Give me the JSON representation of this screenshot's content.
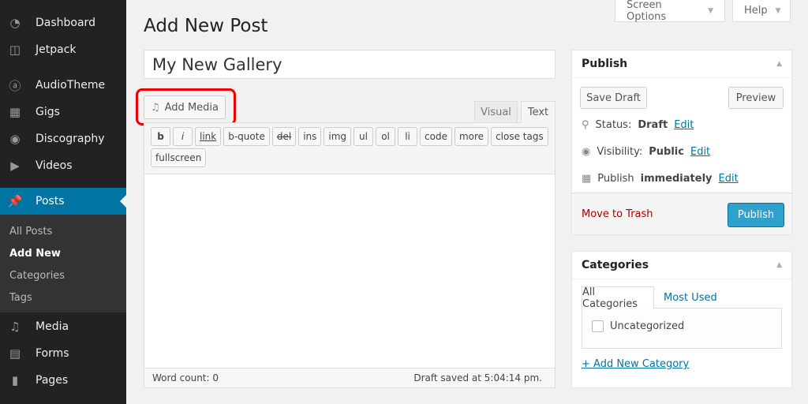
{
  "sidebar": {
    "items": [
      {
        "label": "Dashboard",
        "icon": "dashboard-icon"
      },
      {
        "label": "Jetpack",
        "icon": "jetpack-icon"
      },
      {
        "label": "AudioTheme",
        "icon": "audiotheme-icon"
      },
      {
        "label": "Gigs",
        "icon": "calendar-icon"
      },
      {
        "label": "Discography",
        "icon": "disc-icon"
      },
      {
        "label": "Videos",
        "icon": "video-icon"
      },
      {
        "label": "Posts",
        "icon": "pin-icon"
      },
      {
        "label": "Media",
        "icon": "media-icon"
      },
      {
        "label": "Forms",
        "icon": "forms-icon"
      },
      {
        "label": "Pages",
        "icon": "pages-icon"
      }
    ],
    "submenu": [
      "All Posts",
      "Add New",
      "Categories",
      "Tags"
    ],
    "active": "Posts",
    "active_sub": "Add New"
  },
  "topbar": {
    "screen_options": "Screen Options",
    "help": "Help"
  },
  "page_title": "Add New Post",
  "post_title": "My New Gallery",
  "add_media": "Add Media",
  "tabs": {
    "visual": "Visual",
    "text": "Text",
    "active": "Text"
  },
  "quicktags": [
    "b",
    "i",
    "link",
    "b-quote",
    "del",
    "ins",
    "img",
    "ul",
    "ol",
    "li",
    "code",
    "more",
    "close tags",
    "fullscreen"
  ],
  "status": {
    "word_count": "Word count: 0",
    "draft_saved": "Draft saved at 5:04:14 pm."
  },
  "publish": {
    "title": "Publish",
    "save_draft": "Save Draft",
    "preview": "Preview",
    "status_label": "Status:",
    "status_value": "Draft",
    "visibility_label": "Visibility:",
    "visibility_value": "Public",
    "publish_label": "Publish",
    "publish_value": "immediately",
    "edit": "Edit",
    "trash": "Move to Trash",
    "publish_button": "Publish"
  },
  "categories": {
    "title": "Categories",
    "tab_all": "All Categories",
    "tab_most": "Most Used",
    "items": [
      {
        "label": "Uncategorized",
        "checked": false
      }
    ],
    "add_new": "+ Add New Category"
  },
  "colors": {
    "accent": "#0074a2",
    "sidebar": "#222222",
    "highlight": "#e00000",
    "publish_button": "#2ea2cc"
  }
}
